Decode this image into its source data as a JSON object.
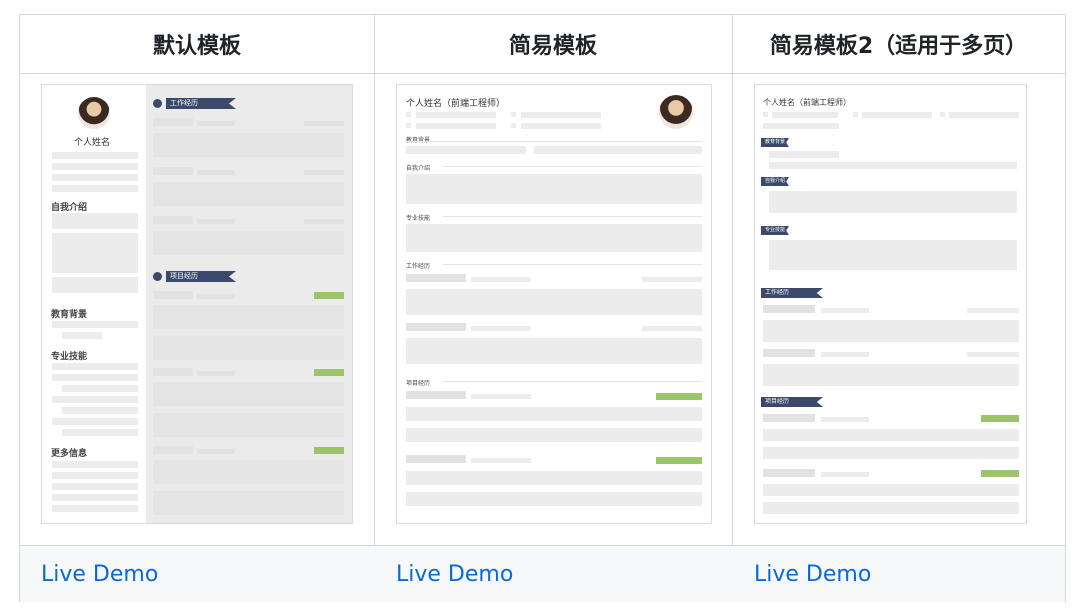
{
  "columns": [
    {
      "title": "默认模板",
      "demo_label": "Live Demo",
      "preview": {
        "name": "个人姓名",
        "sidebar_sections": [
          "自我介绍",
          "教育背景",
          "专业技能",
          "更多信息"
        ],
        "main_sections": [
          "工作经历",
          "项目经历"
        ]
      }
    },
    {
      "title": "简易模板",
      "demo_label": "Live Demo",
      "preview": {
        "name": "个人姓名（前端工程师）",
        "sections": [
          "教育背景",
          "自我介绍",
          "专业技能",
          "工作经历",
          "项目经历"
        ]
      }
    },
    {
      "title": "简易模板2（适用于多页）",
      "demo_label": "Live Demo",
      "preview": {
        "name": "个人姓名（前端工程师）",
        "sections": [
          "教育背景",
          "自我介绍",
          "专业技能",
          "工作经历",
          "项目经历"
        ]
      }
    }
  ],
  "colors": {
    "link": "#0969da",
    "ribbon": "#3b4a6b",
    "accent_bar": "#9cc56b",
    "header_bg": "#f6f8fa"
  }
}
